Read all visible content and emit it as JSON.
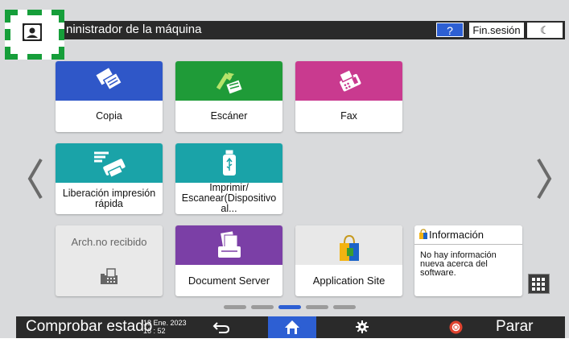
{
  "header": {
    "title": "ninistrador de la máquina",
    "help_label": "?",
    "logout_label": "Fin.sesión",
    "sleep_label": "☾"
  },
  "apps": [
    {
      "label": "Copia",
      "color": "#2f57c8",
      "icon": "copy-icon"
    },
    {
      "label": "Escáner",
      "color": "#1f9b38",
      "icon": "scanner-icon"
    },
    {
      "label": "Fax",
      "color": "#c93a8f",
      "icon": "fax-icon"
    },
    {
      "label": "Liberación impresión rápida",
      "color": "#1aa3a8",
      "icon": "quick-print-icon"
    },
    {
      "label": "Imprimir/ Escanear(Dispositivo al...",
      "color": "#1aa3a8",
      "icon": "usb-icon"
    },
    {
      "label": "Arch.no recibido",
      "color": "#e6e6e6",
      "icon": "fax-document-icon"
    },
    {
      "label": "Document Server",
      "color": "#7b3fa6",
      "icon": "document-server-icon"
    },
    {
      "label": "Application Site",
      "color": "#e8e8e8",
      "icon": "shopping-bag-icon"
    }
  ],
  "info_widget": {
    "title": "Información",
    "message": "No hay información nueva acerca del software."
  },
  "page_indicator": {
    "count": 5,
    "active": 3
  },
  "footer": {
    "status_label": "Comprobar estado",
    "date": "18 Ene. 2023",
    "time": "16 : 52",
    "stop_label": "Parar"
  },
  "colors": {
    "accent_blue": "#2d5fd3",
    "user_badge_green": "#169e3a",
    "bar_dark": "#2a2a2a"
  }
}
